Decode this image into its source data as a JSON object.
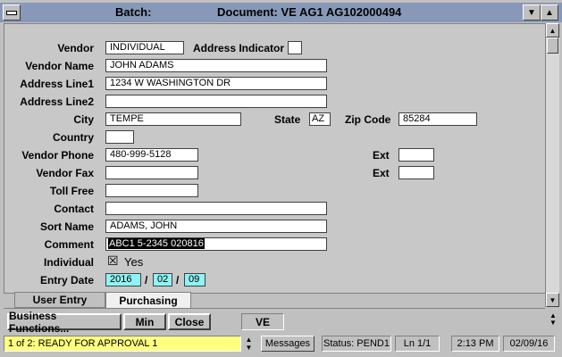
{
  "window": {
    "title_left": "Batch:",
    "title_doc": "Document: VE   AG1  AG102000494"
  },
  "form": {
    "vendor_label": "Vendor",
    "vendor_value": "INDIVIDUAL",
    "address_indicator_label": "Address Indicator",
    "vendor_name_label": "Vendor Name",
    "vendor_name_value": "JOHN ADAMS",
    "address1_label": "Address Line1",
    "address1_value": "1234 W WASHINGTON DR",
    "address2_label": "Address Line2",
    "address2_value": "",
    "city_label": "City",
    "city_value": "TEMPE",
    "state_label": "State",
    "state_value": "AZ",
    "zip_label": "Zip Code",
    "zip_value": "85284",
    "country_label": "Country",
    "country_value": "",
    "phone_label": "Vendor Phone",
    "phone_value": "480-999-5128",
    "ext_label": "Ext",
    "phone_ext_value": "",
    "fax_label": "Vendor Fax",
    "fax_value": "",
    "fax_ext_value": "",
    "tollfree_label": "Toll Free",
    "tollfree_value": "",
    "contact_label": "Contact",
    "contact_value": "",
    "sort_name_label": "Sort Name",
    "sort_name_value": "ADAMS, JOHN",
    "comment_label": "Comment",
    "comment_value": "ABC1 5-2345 020816",
    "individual_label": "Individual",
    "individual_checked": "☒",
    "individual_value": "Yes",
    "entry_date_label": "Entry Date",
    "entry_year": "2016",
    "entry_month": "02",
    "entry_day": "09",
    "date_sep": "/"
  },
  "tabs": [
    {
      "label": "User Entry"
    },
    {
      "label": "Purchasing"
    }
  ],
  "buttons": {
    "business_functions": "Business Functions...",
    "min": "Min",
    "close": "Close",
    "doc_type": "VE"
  },
  "status_bar": {
    "message": "1 of 2: READY FOR APPROVAL 1",
    "messages_button": "Messages",
    "status": "Status: PEND1",
    "line": "Ln 1/1",
    "time": "2:13 PM",
    "date": "02/09/16"
  },
  "colors": {
    "titlebar": "#8898b8",
    "date_field": "#8ff3f3",
    "status_message": "#ffff80"
  }
}
